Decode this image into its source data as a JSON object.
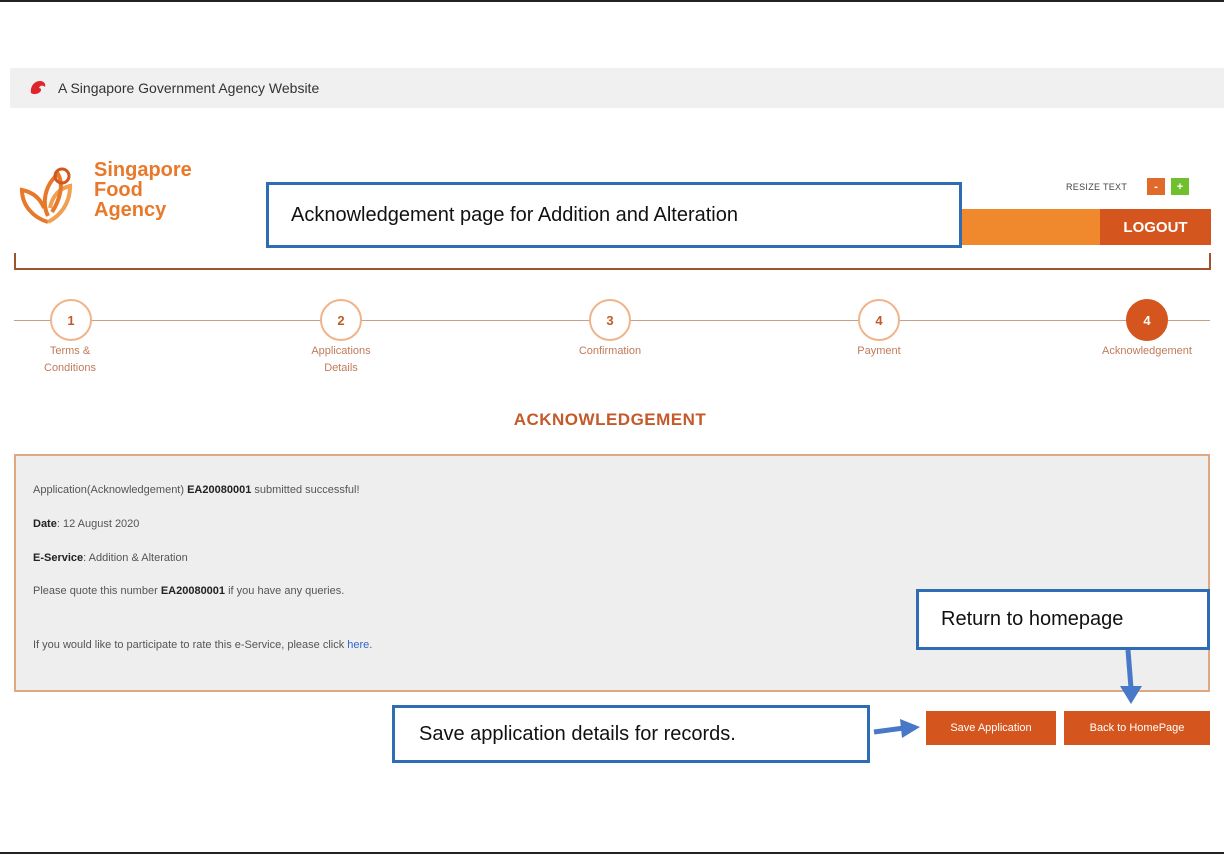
{
  "gov_banner": {
    "text": "A Singapore Government Agency Website"
  },
  "logo": {
    "line1": "Singapore",
    "line2": "Food",
    "line3": "Agency"
  },
  "resize": {
    "label": "RESIZE TEXT",
    "minus": "-",
    "plus": "+"
  },
  "header": {
    "logout_label": "LOGOUT"
  },
  "steps": [
    {
      "number": "1",
      "label_line1": "Terms &",
      "label_line2": "Conditions",
      "active": false
    },
    {
      "number": "2",
      "label_line1": "Applications",
      "label_line2": "Details",
      "active": false
    },
    {
      "number": "3",
      "label_line1": "Confirmation",
      "label_line2": "",
      "active": false
    },
    {
      "number": "4",
      "label_line1": "Payment",
      "label_line2": "",
      "active": false
    },
    {
      "number": "4",
      "label_line1": "Acknowledgement",
      "label_line2": "",
      "active": true
    }
  ],
  "page_title": "ACKNOWLEDGEMENT",
  "ack": {
    "submitted_prefix": "Application(Acknowledgement) ",
    "application_id": "EA20080001",
    "submitted_suffix": " submitted successful!",
    "date_label": "Date",
    "date_value": ": 12 August 2020",
    "service_label": "E-Service",
    "service_value": ": Addition & Alteration",
    "quote_prefix": "Please quote this number ",
    "quote_suffix": " if you have any queries.",
    "rate_text": "If you would like to participate to rate this e-Service, please click ",
    "rate_link": "here",
    "rate_end": "."
  },
  "buttons": {
    "save": "Save Application",
    "home": "Back to HomePage"
  },
  "callouts": {
    "top": "Acknowledgement page for Addition and Alteration",
    "return": "Return to homepage",
    "save": "Save application details for records."
  },
  "colors": {
    "brand_orange": "#d4561e",
    "accent_orange": "#f0892e",
    "callout_blue": "#2e6db4"
  }
}
